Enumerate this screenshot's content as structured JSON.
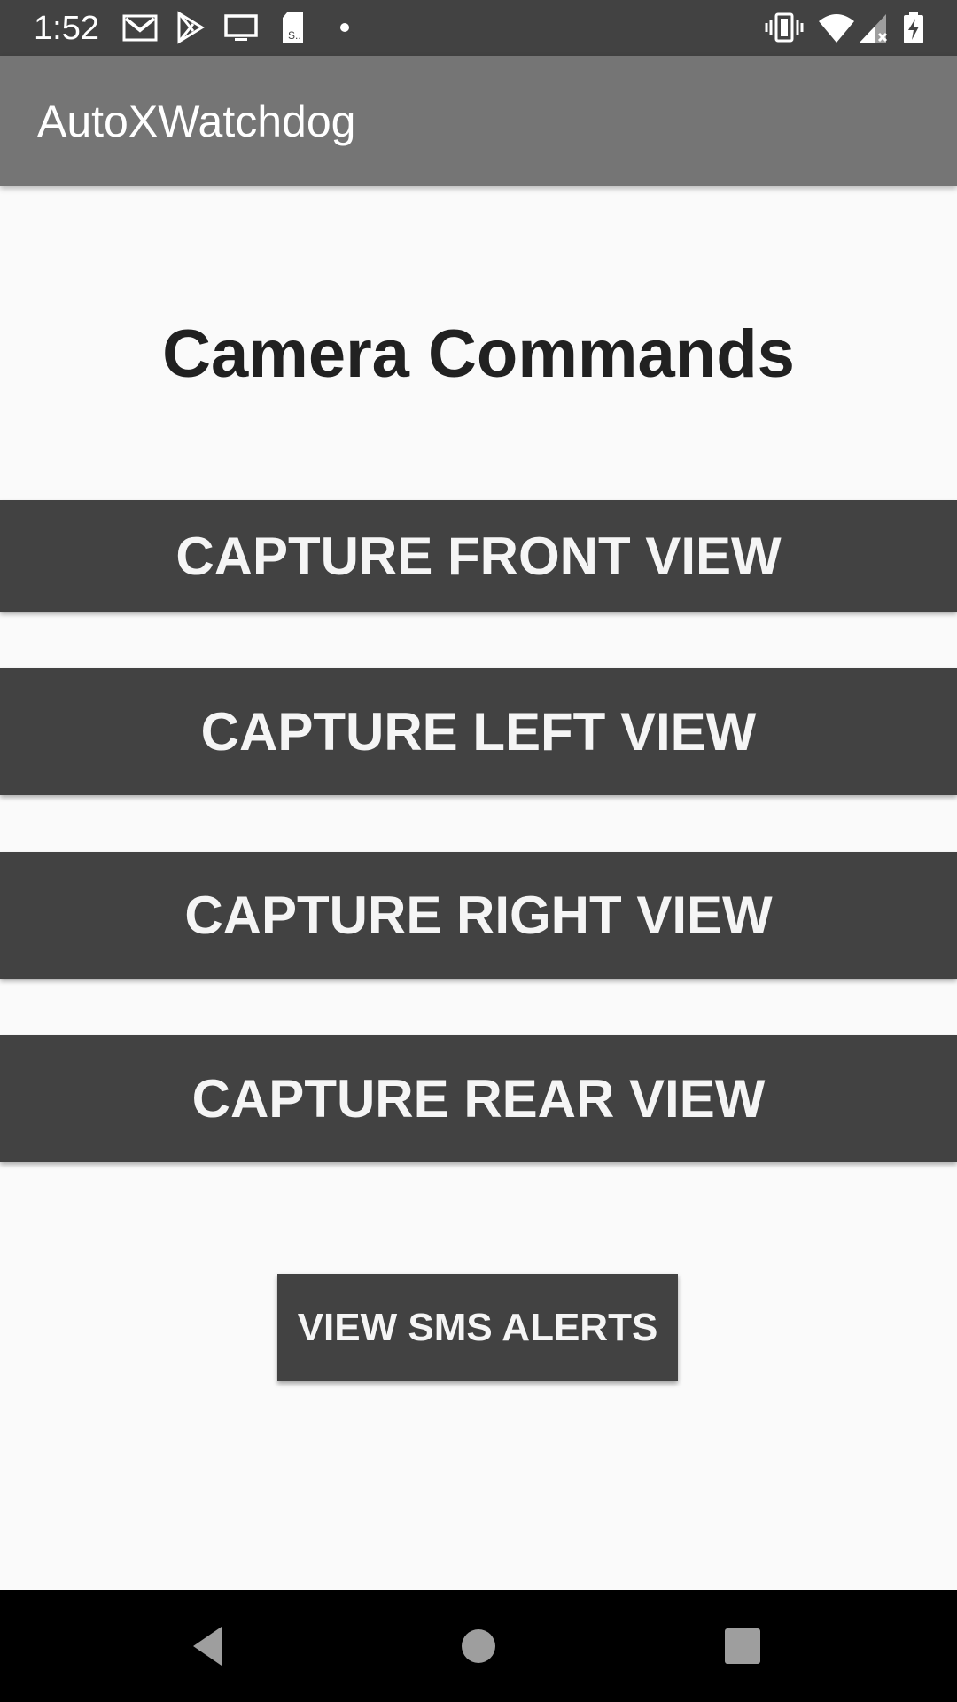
{
  "status_bar": {
    "time": "1:52",
    "left_icons": [
      "gmail-icon",
      "play-store-icon",
      "cast-screen-icon",
      "sd-card-icon",
      "notification-dot-icon"
    ],
    "right_icons": [
      "vibrate-icon",
      "wifi-icon",
      "signal-icon",
      "battery-charging-icon"
    ]
  },
  "app_bar": {
    "title": "AutoXWatchdog"
  },
  "main": {
    "heading": "Camera Commands",
    "buttons": [
      {
        "label": "CAPTURE FRONT VIEW"
      },
      {
        "label": "CAPTURE LEFT VIEW"
      },
      {
        "label": "CAPTURE RIGHT VIEW"
      },
      {
        "label": "CAPTURE REAR VIEW"
      }
    ],
    "sms_button": "VIEW SMS ALERTS"
  },
  "nav_bar": {
    "icons": [
      "back-icon",
      "home-icon",
      "recents-icon"
    ]
  },
  "colors": {
    "status_bar": "#424242",
    "app_bar": "#757575",
    "button": "#424242",
    "button_text": "#f5f5f5",
    "background": "#fafafa",
    "nav_bar": "#000000"
  }
}
